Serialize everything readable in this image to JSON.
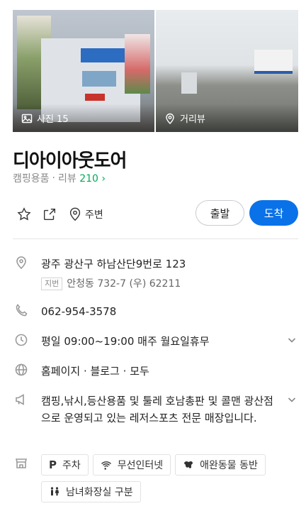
{
  "photos": {
    "left_caption": "사진 15",
    "right_caption": "거리뷰"
  },
  "place": {
    "name": "디아이아웃도어",
    "category": "캠핑용품",
    "review_label": "리뷰",
    "review_count": "210",
    "review_arrow": "›"
  },
  "actions": {
    "nearby_label": "주변",
    "depart_label": "출발",
    "arrive_label": "도착"
  },
  "info": {
    "address": "광주 광산구 하남산단9번로 123",
    "jibun_tag": "지번",
    "jibun_address": "안청동 732-7 (우) 62211",
    "phone": "062-954-3578",
    "hours": "평일 09:00~19:00 매주 월요일휴무",
    "links": "홈페이지 · 블로그 · 모두",
    "description": "캠핑,낚시,등산용품 및 툴레 호남총판 및 콜맨 광산점으로 운영되고 있는 레저스포츠 전문 매장입니다."
  },
  "facilities": [
    {
      "label": "주차",
      "icon": "parking-icon"
    },
    {
      "label": "무선인터넷",
      "icon": "wifi-icon"
    },
    {
      "label": "애완동물 동반",
      "icon": "pet-icon"
    },
    {
      "label": "남녀화장실 구분",
      "icon": "restroom-icon"
    }
  ],
  "colors": {
    "accent": "#0a72e8",
    "review_count": "#03aa5a",
    "link": "#1268d9"
  }
}
